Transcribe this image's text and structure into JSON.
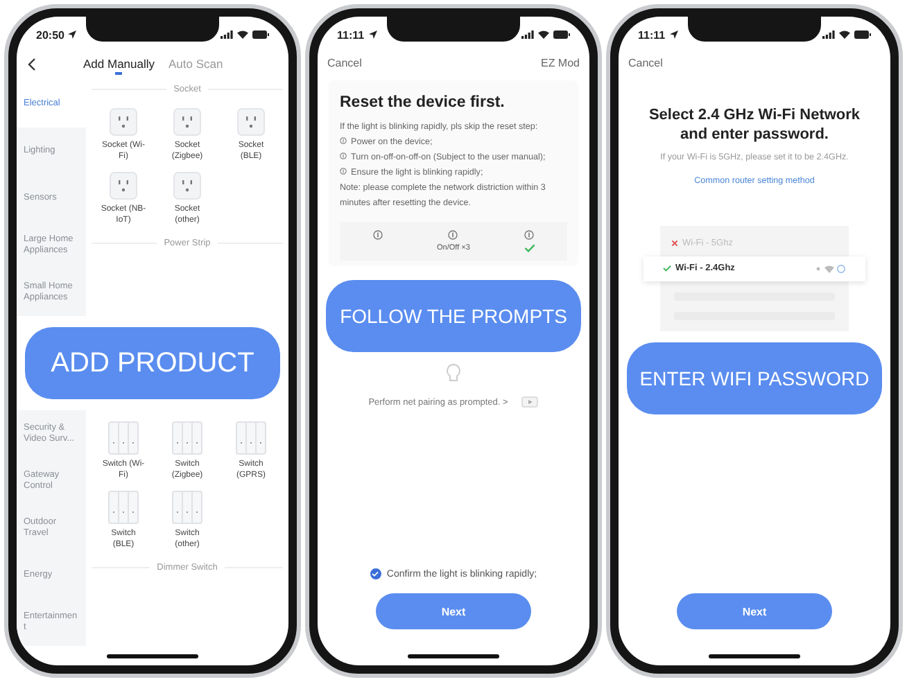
{
  "add_product_phone": {
    "time": "20:50",
    "tabs": [
      {
        "label": "Add Manually",
        "selected": true
      },
      {
        "label": "Auto Scan",
        "selected": false
      }
    ],
    "categories_top": [
      {
        "label": "Electrical",
        "selected": true
      },
      {
        "label": "Lighting",
        "selected": false
      },
      {
        "label": "Sensors",
        "selected": false
      },
      {
        "label": "Large Home Appliances",
        "selected": false
      },
      {
        "label": "Small Home Appliances",
        "selected": false
      }
    ],
    "socket_section": {
      "title": "Socket",
      "devices": [
        {
          "kind": "socket",
          "label": "Socket (Wi-Fi)"
        },
        {
          "kind": "socket",
          "label": "Socket (Zigbee)"
        },
        {
          "kind": "socket",
          "label": "Socket (BLE)"
        },
        {
          "kind": "socket",
          "label": "Socket (NB-IoT)"
        },
        {
          "kind": "socket",
          "label": "Socket (other)"
        }
      ]
    },
    "power_strip_title": "Power Strip",
    "banner": "ADD PRODUCT",
    "categories_bottom": [
      {
        "label": "Security & Video Surv...",
        "selected": false
      },
      {
        "label": "Gateway Control",
        "selected": false
      },
      {
        "label": "Outdoor Travel",
        "selected": false
      },
      {
        "label": "Energy",
        "selected": false
      },
      {
        "label": "Entertainment",
        "selected": false
      }
    ],
    "switch_devices": [
      {
        "kind": "switch",
        "label": "Switch (Wi-Fi)"
      },
      {
        "kind": "switch",
        "label": "Switch (Zigbee)"
      },
      {
        "kind": "switch",
        "label": "Switch (GPRS)"
      },
      {
        "kind": "switch",
        "label": "Switch (BLE)"
      },
      {
        "kind": "switch",
        "label": "Switch (other)"
      }
    ],
    "dimmer_title": "Dimmer Switch"
  },
  "reset_phone": {
    "time": "11:11",
    "cancel": "Cancel",
    "mode": "EZ Mod",
    "title": "Reset the device first.",
    "intro": "If the light is blinking rapidly, pls skip the reset step:",
    "steps": [
      "Power on the device;",
      "Turn on-off-on-off-on (Subject to the user manual);",
      "Ensure the light is blinking rapidly;"
    ],
    "note": "Note: please complete the network distriction within 3 minutes after resetting the device.",
    "indicators": [
      {
        "kind": "plain"
      },
      {
        "kind": "labeled",
        "label": "On/Off ×3"
      },
      {
        "kind": "done"
      }
    ],
    "banner": "FOLLOW THE PROMPTS",
    "pairing_hint": "Perform net pairing as prompted. >",
    "confirm": {
      "label": "Confirm the light is blinking rapidly;",
      "checked": true
    },
    "next": "Next"
  },
  "wifi_phone": {
    "time": "11:11",
    "cancel": "Cancel",
    "title": "Select 2.4 GHz Wi-Fi Network and enter password.",
    "hint": "If your Wi-Fi is 5GHz, please set it to be 2.4GHz.",
    "link": "Common router setting method",
    "networks": [
      {
        "name": "Wi-Fi - 5Ghz",
        "selected": false
      },
      {
        "name": "Wi-Fi - 2.4Ghz",
        "selected": true
      }
    ],
    "banner": "ENTER WIFI PASSWORD",
    "next": "Next"
  }
}
